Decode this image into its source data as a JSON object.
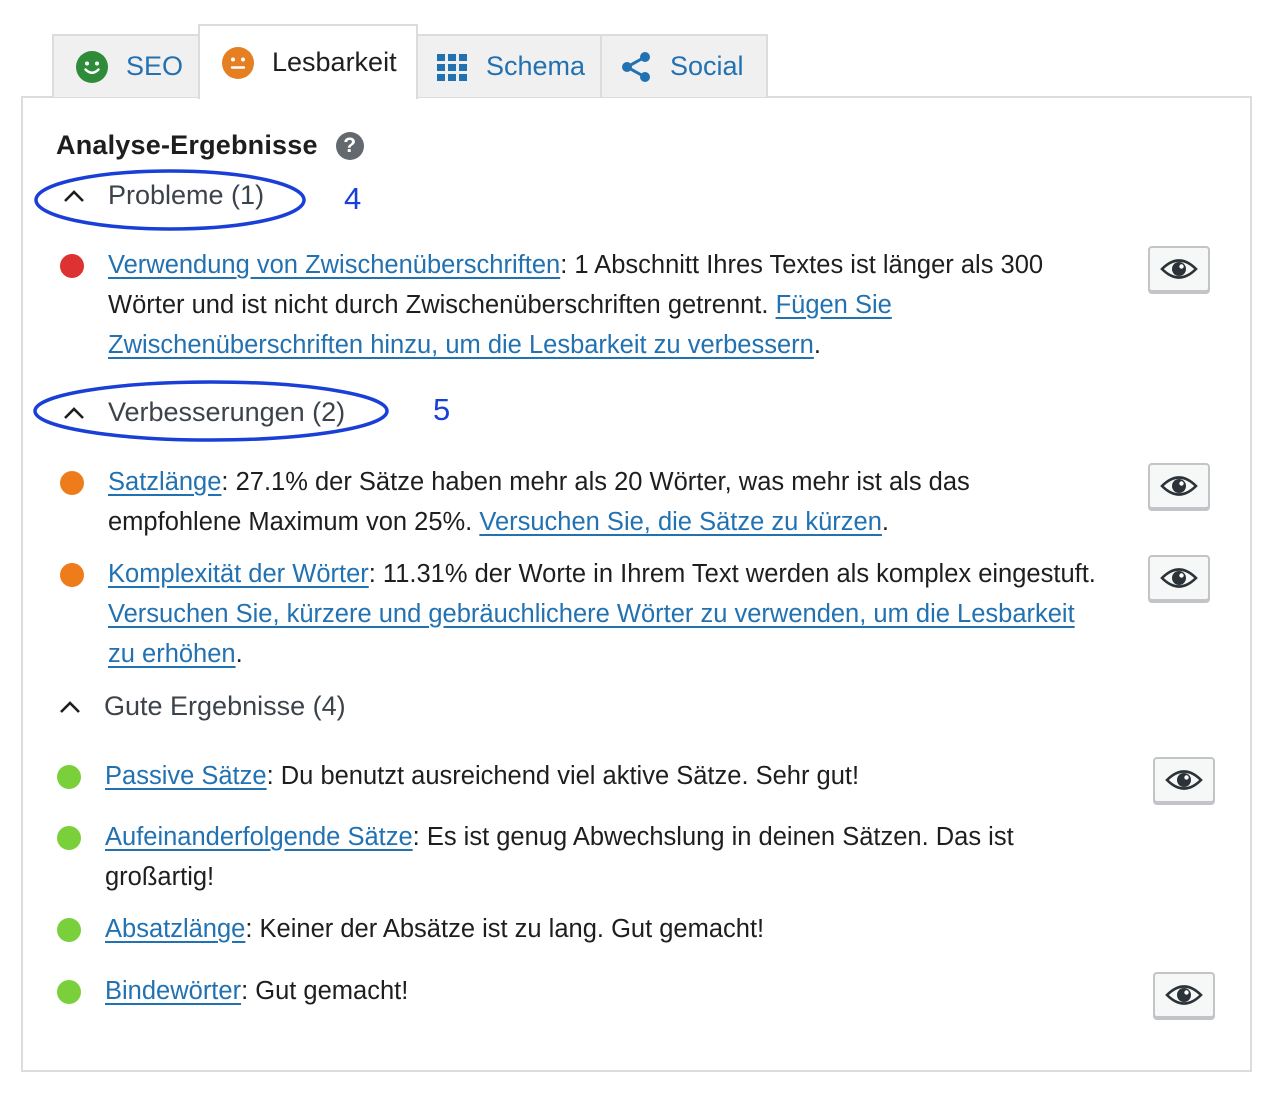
{
  "tabs": [
    {
      "label": "SEO",
      "icon": "smiley-happy-icon",
      "color": "#2e8b3a"
    },
    {
      "label": "Lesbarkeit",
      "icon": "smiley-neutral-icon",
      "color": "#e67e22"
    },
    {
      "label": "Schema",
      "icon": "grid-icon",
      "color": "#2271b1"
    },
    {
      "label": "Social",
      "icon": "share-icon",
      "color": "#2271b1"
    }
  ],
  "active_tab": "Lesbarkeit",
  "panel": {
    "title": "Analyse-Ergebnisse",
    "help_label": "?"
  },
  "colors": {
    "link": "#2271b1",
    "problem": "#dc3232",
    "improvement": "#ee7c1b",
    "good": "#7ad03a",
    "annotation": "#1a3fd6"
  },
  "annotations": [
    "4",
    "5"
  ],
  "sections": {
    "problems": {
      "heading": "Probleme (1)",
      "items": [
        {
          "link": "Verwendung von Zwischenüberschriften",
          "text": ": 1 Abschnitt Ihres Textes ist länger als 300 Wörter und ist nicht durch Zwischenüberschriften getrennt. ",
          "link2": "Fügen Sie Zwischenüberschriften hinzu, um die Lesbarkeit zu verbessern",
          "tail": "."
        }
      ]
    },
    "improvements": {
      "heading": "Verbesserungen (2)",
      "items": [
        {
          "link": "Satzlänge",
          "text": ": 27.1% der Sätze haben mehr als 20 Wörter, was mehr ist als das empfohlene Maximum von 25%. ",
          "link2": "Versuchen Sie, die Sätze zu kürzen",
          "tail": "."
        },
        {
          "link": "Komplexität der Wörter",
          "text": ": 11.31% der Worte in Ihrem Text werden als komplex eingestuft. ",
          "link2": "Versuchen Sie, kürzere und gebräuchlichere Wörter zu verwenden, um die Lesbarkeit zu erhöhen",
          "tail": "."
        }
      ]
    },
    "good": {
      "heading": "Gute Ergebnisse (4)",
      "items": [
        {
          "link": "Passive Sätze",
          "text": ": Du benutzt ausreichend viel aktive Sätze. Sehr gut!",
          "link2": "",
          "tail": ""
        },
        {
          "link": "Aufeinanderfolgende Sätze",
          "text": ": Es ist genug Abwechslung in deinen Sätzen. Das ist großartig!",
          "link2": "",
          "tail": ""
        },
        {
          "link": "Absatzlänge",
          "text": ": Keiner der Absätze ist zu lang. Gut gemacht!",
          "link2": "",
          "tail": ""
        },
        {
          "link": "Bindewörter",
          "text": ": Gut gemacht!",
          "link2": "",
          "tail": ""
        }
      ]
    }
  }
}
